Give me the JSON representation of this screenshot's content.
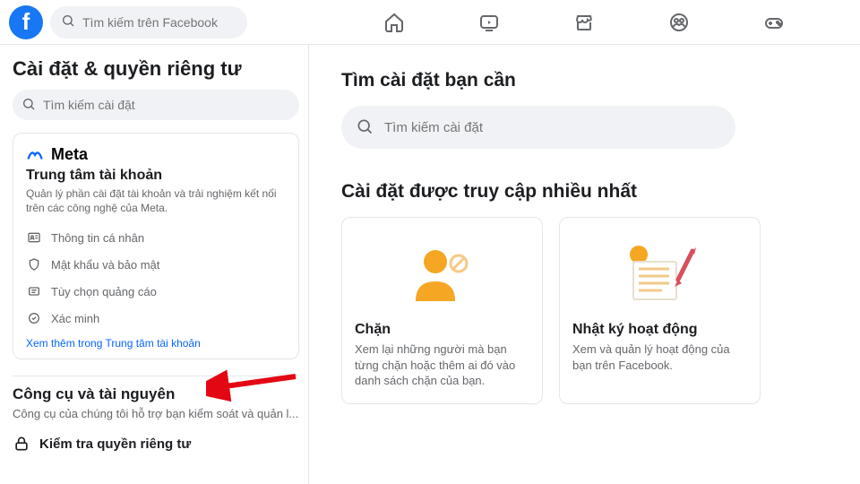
{
  "topbar": {
    "search_placeholder": "Tìm kiếm trên Facebook"
  },
  "sidebar": {
    "title": "Cài đặt & quyền riêng tư",
    "search_placeholder": "Tìm kiếm cài đặt",
    "meta": {
      "brand": "Meta",
      "title": "Trung tâm tài khoản",
      "desc": "Quản lý phần cài đặt tài khoản và trải nghiệm kết nối trên các công nghệ của Meta.",
      "items": [
        {
          "label": "Thông tin cá nhân"
        },
        {
          "label": "Mật khẩu và bảo mật"
        },
        {
          "label": "Tùy chọn quảng cáo"
        },
        {
          "label": "Xác minh"
        }
      ],
      "more": "Xem thêm trong Trung tâm tài khoản"
    },
    "tools": {
      "heading": "Công cụ và tài nguyên",
      "sub": "Công cụ của chúng tôi hỗ trợ bạn kiểm soát và quản l...",
      "item": "Kiểm tra quyền riêng tư"
    }
  },
  "main": {
    "title_find": "Tìm cài đặt bạn cần",
    "search_placeholder": "Tìm kiếm cài đặt",
    "title_most": "Cài đặt được truy cập nhiều nhất",
    "cards": [
      {
        "title": "Chặn",
        "desc": "Xem lại những người mà bạn từng chặn hoặc thêm ai đó vào danh sách chặn của bạn."
      },
      {
        "title": "Nhật ký hoạt động",
        "desc": "Xem và quản lý hoạt động của bạn trên Facebook."
      }
    ]
  },
  "colors": {
    "accent": "#1877f2",
    "link": "#0866ff",
    "muted": "#65676b",
    "orange": "#f5a623"
  }
}
